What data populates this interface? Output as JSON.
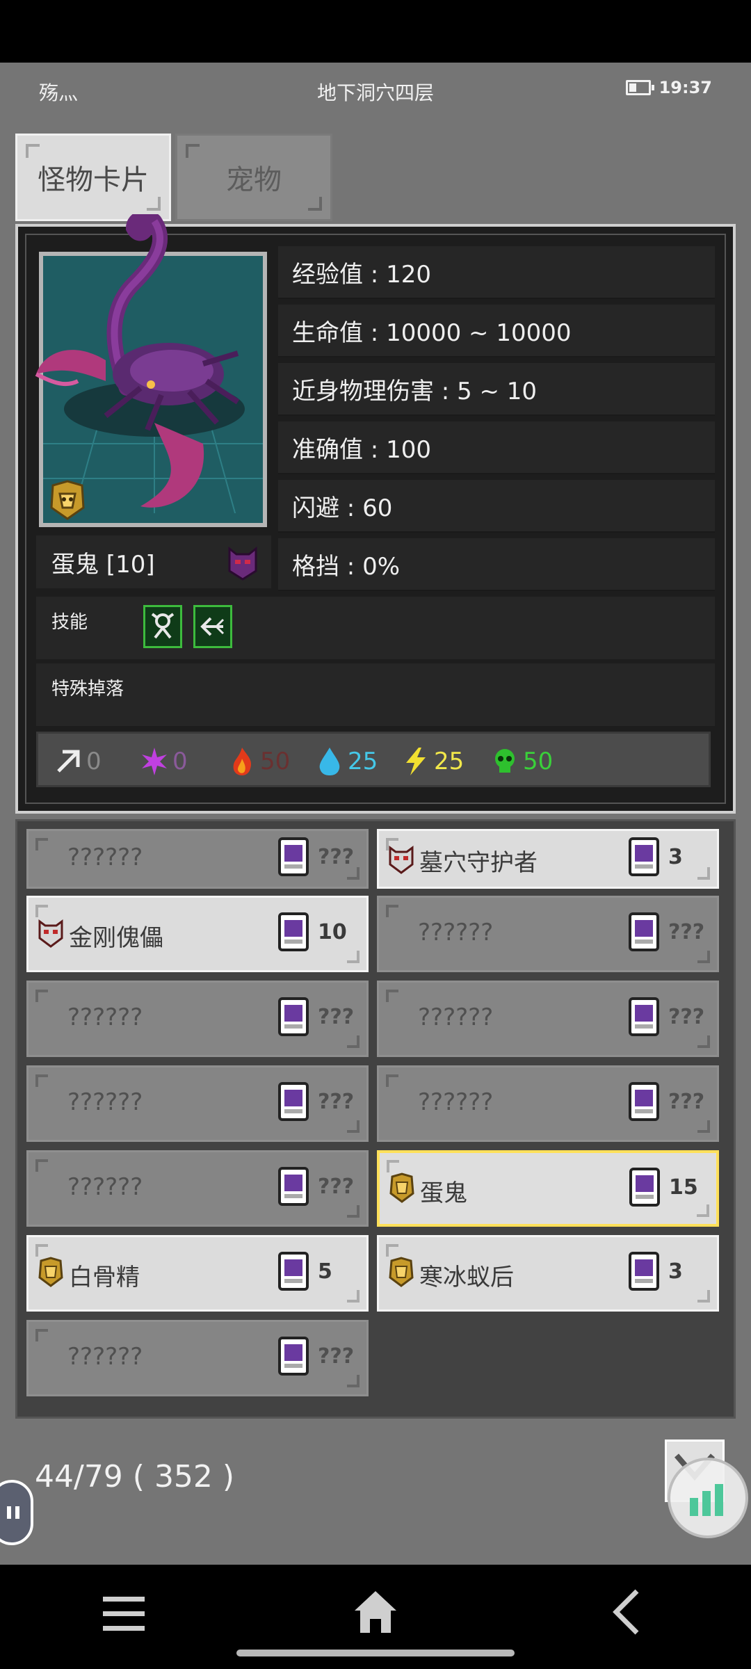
{
  "status": {
    "left_text": "殇灬",
    "title": "地下洞穴四层",
    "time": "19:37",
    "battery_level": 0.4
  },
  "tabs": [
    {
      "label": "怪物卡片",
      "active": true
    },
    {
      "label": "宠物",
      "active": false
    }
  ],
  "monster": {
    "name": "蛋鬼 [10]",
    "stats": {
      "exp": "经验值 : 120",
      "hp": "生命值 : 10000 ~ 10000",
      "melee": "近身物理伤害 : 5 ~ 10",
      "accuracy": "准确值 : 100",
      "evade": "闪避 : 60",
      "block": "格挡 : 0%"
    },
    "skills_label": "技能",
    "special_drop_label": "特殊掉落",
    "skills": [
      "skill-summon-icon",
      "skill-arrow-icon"
    ],
    "resistances": [
      {
        "icon": "physical-icon",
        "value": "0",
        "color": "#8a8a8a"
      },
      {
        "icon": "magic-icon",
        "value": "0",
        "color": "#8a5a9a"
      },
      {
        "icon": "fire-icon",
        "value": "50",
        "color": "#6a3030"
      },
      {
        "icon": "water-icon",
        "value": "25",
        "color": "#45c8e8"
      },
      {
        "icon": "lightning-icon",
        "value": "25",
        "color": "#f2e84a"
      },
      {
        "icon": "poison-icon",
        "value": "50",
        "color": "#3ad03a"
      }
    ]
  },
  "cards": [
    {
      "name": "??????",
      "count": "???",
      "known": false,
      "rank": ""
    },
    {
      "name": "墓穴守护者",
      "count": "3",
      "known": true,
      "rank": "elite"
    },
    {
      "name": "金刚傀儡",
      "count": "10",
      "known": true,
      "rank": "elite"
    },
    {
      "name": "??????",
      "count": "???",
      "known": false,
      "rank": ""
    },
    {
      "name": "??????",
      "count": "???",
      "known": false,
      "rank": ""
    },
    {
      "name": "??????",
      "count": "???",
      "known": false,
      "rank": ""
    },
    {
      "name": "??????",
      "count": "???",
      "known": false,
      "rank": ""
    },
    {
      "name": "??????",
      "count": "???",
      "known": false,
      "rank": ""
    },
    {
      "name": "??????",
      "count": "???",
      "known": false,
      "rank": ""
    },
    {
      "name": "蛋鬼",
      "count": "15",
      "known": true,
      "rank": "gold",
      "selected": true
    },
    {
      "name": "白骨精",
      "count": "5",
      "known": true,
      "rank": "gold"
    },
    {
      "name": "寒冰蚁后",
      "count": "3",
      "known": true,
      "rank": "gold"
    },
    {
      "name": "??????",
      "count": "???",
      "known": false,
      "rank": ""
    }
  ],
  "progress": "44/79 ( 352 )"
}
